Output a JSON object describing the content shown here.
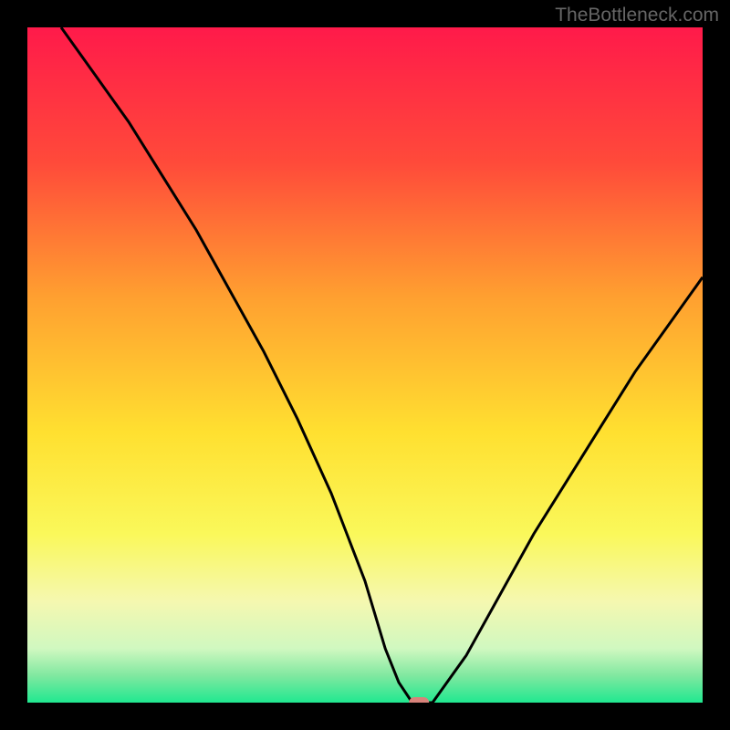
{
  "watermark": "TheBottleneck.com",
  "chart_data": {
    "type": "line",
    "title": "",
    "xlabel": "",
    "ylabel": "",
    "xlim": [
      0,
      100
    ],
    "ylim": [
      0,
      100
    ],
    "background_gradient": {
      "type": "vertical",
      "stops": [
        {
          "pos": 0.0,
          "color": "#ff1a4a"
        },
        {
          "pos": 0.2,
          "color": "#ff4a3a"
        },
        {
          "pos": 0.4,
          "color": "#ffa030"
        },
        {
          "pos": 0.6,
          "color": "#ffe030"
        },
        {
          "pos": 0.75,
          "color": "#faf85a"
        },
        {
          "pos": 0.85,
          "color": "#f5f8b0"
        },
        {
          "pos": 0.92,
          "color": "#d0f8c0"
        },
        {
          "pos": 0.96,
          "color": "#80e8a0"
        },
        {
          "pos": 1.0,
          "color": "#20e890"
        }
      ]
    },
    "series": [
      {
        "name": "bottleneck-curve",
        "color": "#000000",
        "x": [
          5,
          10,
          15,
          20,
          25,
          30,
          35,
          40,
          45,
          50,
          53,
          55,
          57,
          59,
          60,
          65,
          70,
          75,
          80,
          85,
          90,
          95,
          100
        ],
        "y": [
          100,
          93,
          86,
          78,
          70,
          61,
          52,
          42,
          31,
          18,
          8,
          3,
          0,
          0,
          0,
          7,
          16,
          25,
          33,
          41,
          49,
          56,
          63
        ]
      }
    ],
    "marker": {
      "name": "optimal-point",
      "x": 58,
      "y": 0,
      "color": "#d8827a",
      "shape": "rounded-rect"
    }
  }
}
